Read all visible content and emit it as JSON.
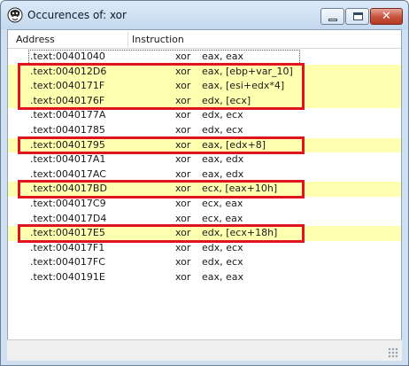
{
  "window": {
    "title": "Occurences of: xor",
    "icon": "app-icon"
  },
  "columns": {
    "address": "Address",
    "instruction": "Instruction"
  },
  "rows": [
    {
      "address": ".text:00401040",
      "mnemonic": "xor",
      "operands": "eax, eax",
      "highlighted": false,
      "selected": true
    },
    {
      "address": ".text:004012D6",
      "mnemonic": "xor",
      "operands": "eax, [ebp+var_10]",
      "highlighted": true,
      "selected": false
    },
    {
      "address": ".text:0040171F",
      "mnemonic": "xor",
      "operands": "eax, [esi+edx*4]",
      "highlighted": true,
      "selected": false
    },
    {
      "address": ".text:0040176F",
      "mnemonic": "xor",
      "operands": "edx, [ecx]",
      "highlighted": true,
      "selected": false
    },
    {
      "address": ".text:0040177A",
      "mnemonic": "xor",
      "operands": "edx, ecx",
      "highlighted": false,
      "selected": false
    },
    {
      "address": ".text:00401785",
      "mnemonic": "xor",
      "operands": "edx, ecx",
      "highlighted": false,
      "selected": false
    },
    {
      "address": ".text:00401795",
      "mnemonic": "xor",
      "operands": "eax, [edx+8]",
      "highlighted": true,
      "selected": false
    },
    {
      "address": ".text:004017A1",
      "mnemonic": "xor",
      "operands": "eax, edx",
      "highlighted": false,
      "selected": false
    },
    {
      "address": ".text:004017AC",
      "mnemonic": "xor",
      "operands": "eax, edx",
      "highlighted": false,
      "selected": false
    },
    {
      "address": ".text:004017BD",
      "mnemonic": "xor",
      "operands": "ecx, [eax+10h]",
      "highlighted": true,
      "selected": false
    },
    {
      "address": ".text:004017C9",
      "mnemonic": "xor",
      "operands": "ecx, eax",
      "highlighted": false,
      "selected": false
    },
    {
      "address": ".text:004017D4",
      "mnemonic": "xor",
      "operands": "ecx, eax",
      "highlighted": false,
      "selected": false
    },
    {
      "address": ".text:004017E5",
      "mnemonic": "xor",
      "operands": "edx, [ecx+18h]",
      "highlighted": true,
      "selected": false
    },
    {
      "address": ".text:004017F1",
      "mnemonic": "xor",
      "operands": "edx, ecx",
      "highlighted": false,
      "selected": false
    },
    {
      "address": ".text:004017FC",
      "mnemonic": "xor",
      "operands": "edx, ecx",
      "highlighted": false,
      "selected": false
    },
    {
      "address": ".text:0040191E",
      "mnemonic": "xor",
      "operands": "eax, eax",
      "highlighted": false,
      "selected": false
    }
  ],
  "annotation_groups": [
    {
      "from_row": 1,
      "to_row": 3
    },
    {
      "from_row": 6,
      "to_row": 6
    },
    {
      "from_row": 9,
      "to_row": 9
    },
    {
      "from_row": 12,
      "to_row": 12
    }
  ],
  "colors": {
    "highlight": "#ffffb0",
    "annotation_box": "#e0141e",
    "close_button": "#c7513a"
  }
}
